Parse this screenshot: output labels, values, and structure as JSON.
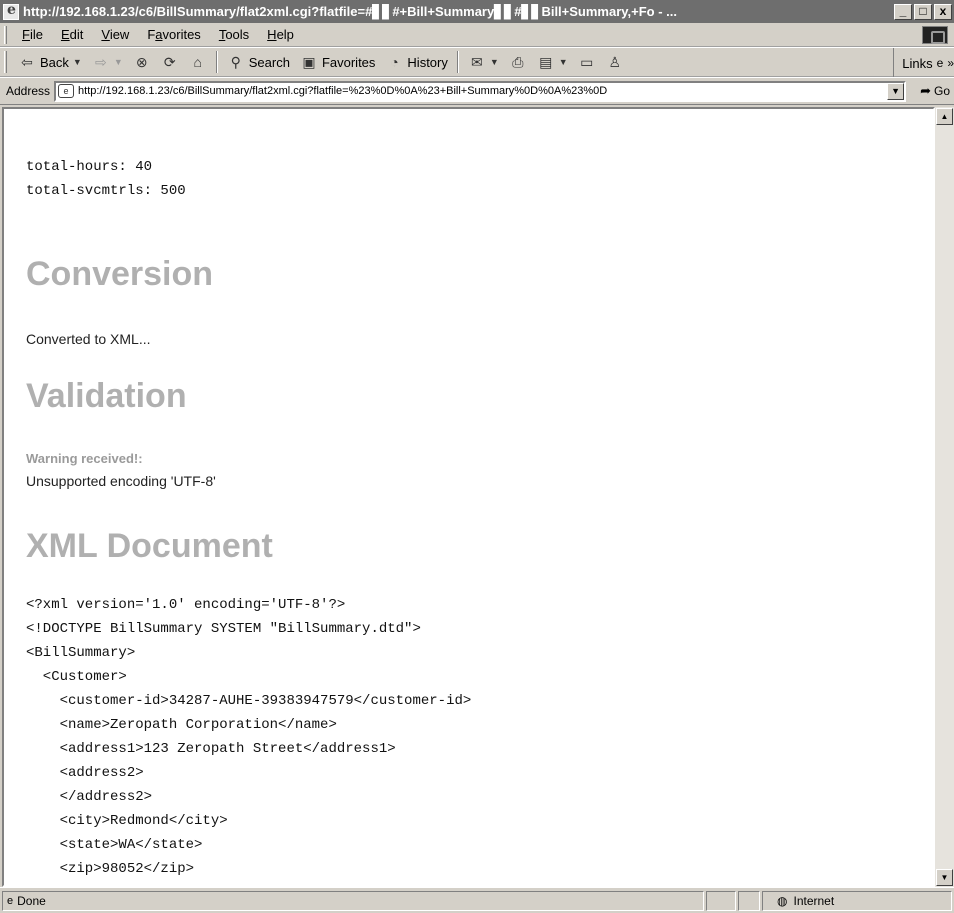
{
  "window": {
    "title": "http://192.168.1.23/c6/BillSummary/flat2xml.cgi?flatfile=#▋▋#+Bill+Summary▋▋#▋▋Bill+Summary,+Fo - ..."
  },
  "menu": {
    "items": [
      {
        "key": "F",
        "rest": "ile"
      },
      {
        "key": "E",
        "rest": "dit"
      },
      {
        "key": "V",
        "rest": "iew"
      },
      {
        "key": "a",
        "pre": "F",
        "rest": "vorites"
      },
      {
        "key": "T",
        "rest": "ools"
      },
      {
        "key": "H",
        "rest": "elp"
      }
    ]
  },
  "toolbar": {
    "back": "Back",
    "search": "Search",
    "favorites": "Favorites",
    "history": "History",
    "links": "Links"
  },
  "address": {
    "label": "Address",
    "url": "http://192.168.1.23/c6/BillSummary/flat2xml.cgi?flatfile=%23%0D%0A%23+Bill+Summary%0D%0A%23%0D",
    "go": "Go"
  },
  "page": {
    "summary_lines": [
      "total-hours: 40",
      "total-svcmtrls: 500"
    ],
    "conversion_heading": "Conversion",
    "conversion_text": "Converted to XML...",
    "validation_heading": "Validation",
    "warning_label": "Warning received!:",
    "warning_text": "Unsupported encoding 'UTF-8'",
    "xml_heading": "XML Document",
    "xml_lines": [
      "<?xml version='1.0' encoding='UTF-8'?>",
      "<!DOCTYPE BillSummary SYSTEM \"BillSummary.dtd\">",
      "<BillSummary>",
      "  <Customer>",
      "    <customer-id>34287-AUHE-39383947579</customer-id>",
      "    <name>Zeropath Corporation</name>",
      "    <address1>123 Zeropath Street</address1>",
      "    <address2>",
      "    </address2>",
      "    <city>Redmond</city>",
      "    <state>WA</state>",
      "    <zip>98052</zip>"
    ]
  },
  "status": {
    "text": "Done",
    "zone": "Internet"
  }
}
